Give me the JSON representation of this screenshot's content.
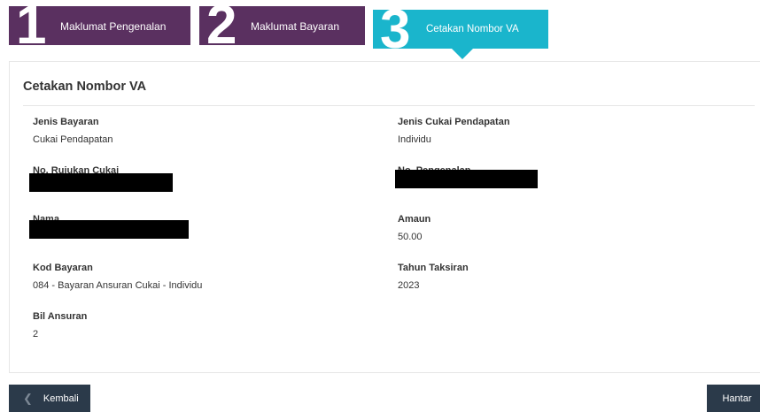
{
  "steps": [
    {
      "number": "1",
      "label": "Maklumat Pengenalan"
    },
    {
      "number": "2",
      "label": "Maklumat Bayaran"
    },
    {
      "number": "3",
      "label": "Cetakan Nombor VA"
    }
  ],
  "panel": {
    "title": "Cetakan Nombor VA",
    "fields": {
      "jenis_bayaran": {
        "label": "Jenis Bayaran",
        "value": "Cukai Pendapatan"
      },
      "jenis_cukai": {
        "label": "Jenis Cukai Pendapatan",
        "value": "Individu"
      },
      "no_rujukan": {
        "label": "No. Rujukan Cukai",
        "value": ""
      },
      "no_pengenalan": {
        "label": "No. Pengenalan",
        "value": ""
      },
      "nama": {
        "label": "Nama",
        "value": ""
      },
      "amaun": {
        "label": "Amaun",
        "value": "50.00"
      },
      "kod_bayaran": {
        "label": "Kod Bayaran",
        "value": "084 - Bayaran Ansuran Cukai - Individu"
      },
      "tahun_taksiran": {
        "label": "Tahun Taksiran",
        "value": "2023"
      },
      "bil_ansuran": {
        "label": "Bil Ansuran",
        "value": "2"
      }
    }
  },
  "buttons": {
    "back": {
      "label": "Kembali",
      "icon": "chevron-left-icon"
    },
    "submit": {
      "label": "Hantar"
    }
  },
  "colors": {
    "step_inactive": "#5a3060",
    "step_active": "#1ab5cc",
    "button": "#2b3a4a"
  }
}
